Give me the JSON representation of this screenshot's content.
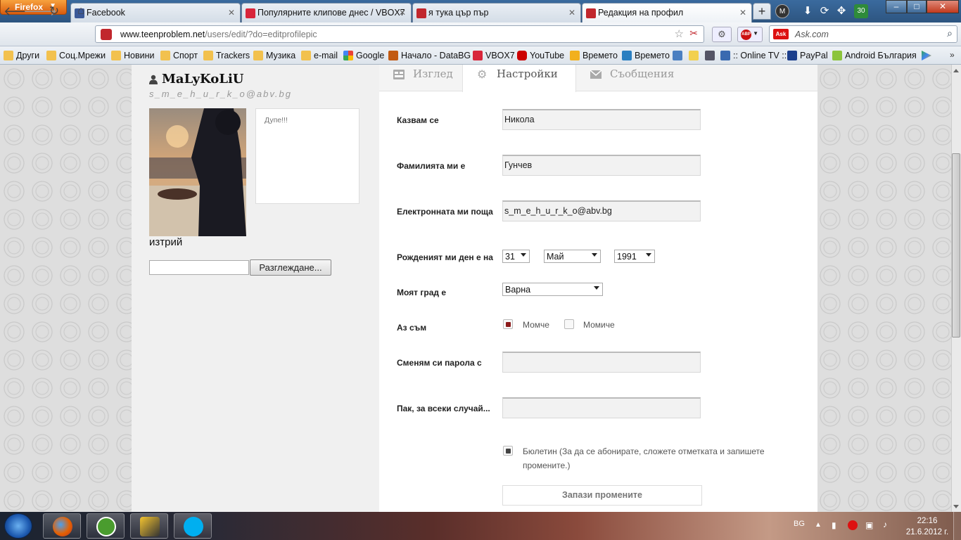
{
  "browser": {
    "menu_button": "Firefox",
    "tabs": [
      {
        "label": "Facebook",
        "favicon_color": "#3b5998"
      },
      {
        "label": "Популярните клипове днес / VBOX7",
        "favicon_color": "#d8253a"
      },
      {
        "label": "я тука цър пър",
        "favicon_color": "#c1272d"
      },
      {
        "label": "Редакция на профил",
        "favicon_color": "#c1272d"
      }
    ],
    "new_tab": "+",
    "window_controls": {
      "minimize": "–",
      "maximize": "□",
      "close": "✕"
    },
    "toolbar_badge": "30",
    "url": {
      "domain": "www.teenproblem.net",
      "path": "/users/edit/?do=editprofilepic"
    },
    "search_placeholder": "Ask.com",
    "search_engine_label": "Ask",
    "adblock_label": "ABP"
  },
  "bookmarks": [
    {
      "label": "Други",
      "icon": "folder-icon"
    },
    {
      "label": "Соц.Мрежи",
      "icon": "folder-icon"
    },
    {
      "label": "Новини",
      "icon": "folder-icon"
    },
    {
      "label": "Спорт",
      "icon": "folder-icon"
    },
    {
      "label": "Trackers",
      "icon": "folder-icon"
    },
    {
      "label": "Музика",
      "icon": "folder-icon"
    },
    {
      "label": "e-mail",
      "icon": "folder-icon"
    },
    {
      "label": "Google",
      "icon": "google-icon"
    },
    {
      "label": "Начало - DataBG",
      "icon": "databg-icon"
    },
    {
      "label": "VBOX7",
      "icon": "vbox7-icon"
    },
    {
      "label": "YouTube",
      "icon": "youtube-icon"
    },
    {
      "label": "Времето",
      "icon": "weather-icon"
    },
    {
      "label": "Времето",
      "icon": "weather-v-icon"
    },
    {
      "label": ":: Online TV ::",
      "icon": "tv-icon"
    },
    {
      "label": "PayPal",
      "icon": "paypal-icon"
    },
    {
      "label": "Android България",
      "icon": "android-icon"
    }
  ],
  "profile": {
    "username": "MaLyKoLiU",
    "email": "s_m_e_h_u_r_k_o@abv.bg",
    "status_text": "Дупе!!!",
    "delete_label": "изтрий",
    "browse_label": "Разглеждане..."
  },
  "panel_tabs": [
    {
      "label": "Изглед",
      "icon": "layout-icon"
    },
    {
      "label": "Настройки",
      "icon": "gear-icon"
    },
    {
      "label": "Съобщения",
      "icon": "envelope-icon"
    }
  ],
  "form": {
    "first_name": {
      "label": "Казвам се",
      "value": "Никола"
    },
    "last_name": {
      "label": "Фамилията ми е",
      "value": "Гунчев"
    },
    "email": {
      "label": "Електронната ми поща",
      "value": "s_m_e_h_u_r_k_o@abv.bg"
    },
    "birthday": {
      "label": "Рожденият ми ден е на",
      "day": "31",
      "month": "Май",
      "year": "1991"
    },
    "city": {
      "label": "Моят град е",
      "value": "Варна"
    },
    "gender": {
      "label": "Аз съм",
      "male": "Момче",
      "female": "Момиче",
      "selected": "male"
    },
    "password": {
      "label": "Сменям си парола с",
      "value": ""
    },
    "password_confirm": {
      "label": "Пак, за всеки случай...",
      "value": ""
    },
    "newsletter": {
      "text": "Бюлетин (За да се абонирате, сложете отметката и запишете промените.)",
      "checked": true
    },
    "save_label": "Запази промените"
  },
  "taskbar": {
    "language": "BG",
    "time": "22:16",
    "date": "21.6.2012 г."
  },
  "colors": {
    "accent": "#8c1a1a",
    "page_bg": "#f0f0f0",
    "firefox_orange": "#e66000"
  }
}
